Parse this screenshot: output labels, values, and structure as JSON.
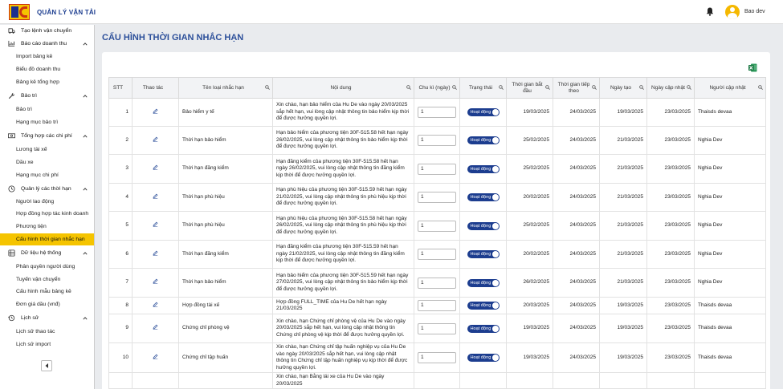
{
  "app": {
    "brand": "QUẢN LÝ VẬN TẢI",
    "user_name": "Bao dev"
  },
  "sidebar": {
    "items": [
      {
        "label": "Tạo lệnh vận chuyển",
        "type": "group",
        "icon": "truck-icon",
        "chevron": false
      },
      {
        "label": "Báo cáo doanh thu",
        "type": "group",
        "icon": "chart-icon",
        "chevron": true
      },
      {
        "label": "Import bảng kê",
        "type": "sub"
      },
      {
        "label": "Biểu đồ doanh thu",
        "type": "sub"
      },
      {
        "label": "Bảng kê tổng hợp",
        "type": "sub"
      },
      {
        "label": "Bảo trì",
        "type": "group",
        "icon": "wrench-icon",
        "chevron": true
      },
      {
        "label": "Bảo trì",
        "type": "sub"
      },
      {
        "label": "Hạng mục bảo trì",
        "type": "sub"
      },
      {
        "label": "Tổng hợp các chi phí",
        "type": "group",
        "icon": "money-icon",
        "chevron": true
      },
      {
        "label": "Lương tài xế",
        "type": "sub"
      },
      {
        "label": "Dầu xe",
        "type": "sub"
      },
      {
        "label": "Hạng mục chi phí",
        "type": "sub"
      },
      {
        "label": "Quản lý các thời hạn",
        "type": "group",
        "icon": "clock-icon",
        "chevron": true
      },
      {
        "label": "Người lao động",
        "type": "sub"
      },
      {
        "label": "Hợp đồng hợp tác kinh doanh",
        "type": "sub"
      },
      {
        "label": "Phương tiện",
        "type": "sub"
      },
      {
        "label": "Cấu hình thời gian nhắc hạn",
        "type": "sub",
        "active": true
      },
      {
        "label": "Dữ liệu hệ thống",
        "type": "group",
        "icon": "database-icon",
        "chevron": true
      },
      {
        "label": "Phân quyền người dùng",
        "type": "sub"
      },
      {
        "label": "Tuyến vận chuyển",
        "type": "sub"
      },
      {
        "label": "Cấu hình mẫu bảng kê",
        "type": "sub"
      },
      {
        "label": "Đơn giá dầu (vnđ)",
        "type": "sub"
      },
      {
        "label": "Lịch sử",
        "type": "group",
        "icon": "history-icon",
        "chevron": true
      },
      {
        "label": "Lịch sử thao tác",
        "type": "sub"
      },
      {
        "label": "Lịch sử import",
        "type": "sub"
      }
    ]
  },
  "page": {
    "title": "CẤU HÌNH THỜI GIAN NHẮC HẠN"
  },
  "table": {
    "columns": [
      "STT",
      "Thao tác",
      "Tên loại nhắc hạn",
      "Nội dung",
      "Chu kì (ngày)",
      "Trạng thái",
      "Thời gian bắt đầu",
      "Thời gian tiếp theo",
      "Ngày tạo",
      "Ngày cập nhật",
      "Người cập nhật"
    ],
    "rows": [
      {
        "stt": "1",
        "name": "Bảo hiểm y tế",
        "content": "Xin chào, hạn bảo hiểm của Hu De vào ngày 20/03/2025 sắp hết hạn, vui lòng cập nhật thông tin bảo hiểm kịp thời để được hưởng quyền lợi.",
        "cycle": "1",
        "status": "Hoạt động",
        "start": "19/03/2025",
        "next": "24/03/2025",
        "created": "19/03/2025",
        "updated": "23/03/2025",
        "updater": "Thaisds devaa"
      },
      {
        "stt": "2",
        "name": "Thời hạn bảo hiểm",
        "content": "Hạn bảo hiểm của phương tiện 30F-515.58 hết hạn ngày 26/02/2025, vui lòng cập nhật thông tin bảo hiểm kịp thời để được hưởng quyền lợi.",
        "cycle": "1",
        "status": "Hoạt động",
        "start": "25/02/2025",
        "next": "24/03/2025",
        "created": "21/03/2025",
        "updated": "23/03/2025",
        "updater": "Nghia Dev"
      },
      {
        "stt": "3",
        "name": "Thời hạn đăng kiểm",
        "content": "Hạn đăng kiểm của phương tiện 30F-515.58 hết hạn ngày 26/02/2025, vui lòng cập nhật thông tin đăng kiểm kịp thời để được hưởng quyền lợi.",
        "cycle": "1",
        "status": "Hoạt động",
        "start": "25/02/2025",
        "next": "24/03/2025",
        "created": "21/03/2025",
        "updated": "23/03/2025",
        "updater": "Nghia Dev"
      },
      {
        "stt": "4",
        "name": "Thời hạn phù hiệu",
        "content": "Hạn phù hiệu của phương tiện 30F-515.59 hết hạn ngày 21/02/2025, vui lòng cập nhật thông tin phù hiệu kịp thời để được hưởng quyền lợi.",
        "cycle": "1",
        "status": "Hoạt động",
        "start": "20/02/2025",
        "next": "24/03/2025",
        "created": "21/03/2025",
        "updated": "23/03/2025",
        "updater": "Nghia Dev"
      },
      {
        "stt": "5",
        "name": "Thời hạn phù hiệu",
        "content": "Hạn phù hiệu của phương tiện 30F-515.58 hết hạn ngày 26/02/2025, vui lòng cập nhật thông tin phù hiệu kịp thời để được hưởng quyền lợi.",
        "cycle": "1",
        "status": "Hoạt động",
        "start": "25/02/2025",
        "next": "24/03/2025",
        "created": "21/03/2025",
        "updated": "23/03/2025",
        "updater": "Nghia Dev"
      },
      {
        "stt": "6",
        "name": "Thời hạn đăng kiểm",
        "content": "Hạn đăng kiểm của phương tiện 30F-515.59 hết hạn ngày 21/02/2025, vui lòng cập nhật thông tin đăng kiểm kịp thời để được hưởng quyền lợi.",
        "cycle": "1",
        "status": "Hoạt động",
        "start": "20/02/2025",
        "next": "24/03/2025",
        "created": "21/03/2025",
        "updated": "23/03/2025",
        "updater": "Nghia Dev"
      },
      {
        "stt": "7",
        "name": "Thời hạn bảo hiểm",
        "content": "Hạn bảo hiểm của phương tiện 30F-515.59 hết hạn ngày 27/02/2025, vui lòng cập nhật thông tin bảo hiểm kịp thời để được hưởng quyền lợi.",
        "cycle": "1",
        "status": "Hoạt động",
        "start": "26/02/2025",
        "next": "24/03/2025",
        "created": "21/03/2025",
        "updated": "23/03/2025",
        "updater": "Nghia Dev"
      },
      {
        "stt": "8",
        "name": "Hợp đồng tài xế",
        "content": "Hợp đồng FULL_TIME của Hu De hết hạn ngày 21/03/2025",
        "cycle": "1",
        "status": "Hoạt động",
        "start": "20/03/2025",
        "next": "24/03/2025",
        "created": "19/03/2025",
        "updated": "23/03/2025",
        "updater": "Thaisds devaa"
      },
      {
        "stt": "9",
        "name": "Chứng chỉ phòng vệ",
        "content": "Xin chào, hạn Chứng chỉ phòng vệ của Hu De vào ngày 20/03/2025 sắp hết hạn, vui lòng cập nhật thông tin Chứng chỉ phòng vệ kịp thời để được hưởng quyền lợi.",
        "cycle": "1",
        "status": "Hoạt động",
        "start": "19/03/2025",
        "next": "24/03/2025",
        "created": "19/03/2025",
        "updated": "23/03/2025",
        "updater": "Thaisds devaa"
      },
      {
        "stt": "10",
        "name": "Chứng chỉ tập huấn",
        "content": "Xin chào, hạn Chứng chỉ tập huấn nghiệp vụ của Hu De vào ngày 20/03/2025 sắp hết hạn, vui lòng cập nhật thông tin Chứng chỉ tập huấn nghiệp vụ kịp thời để được hưởng quyền lợi.",
        "cycle": "1",
        "status": "Hoạt động",
        "start": "19/03/2025",
        "next": "24/03/2025",
        "created": "19/03/2025",
        "updated": "23/03/2025",
        "updater": "Thaisds devaa"
      },
      {
        "stt": "",
        "name": "",
        "content": "Xin chào, hạn Bằng lái xe của Hu De vào ngày 20/03/2025",
        "cycle": "",
        "status": "",
        "start": "",
        "next": "",
        "created": "",
        "updated": "",
        "updater": ""
      }
    ]
  },
  "colors": {
    "accent": "#f5c400",
    "primary": "#1c3d8f",
    "title": "#2c4f9a",
    "excel": "#1d7a45"
  }
}
